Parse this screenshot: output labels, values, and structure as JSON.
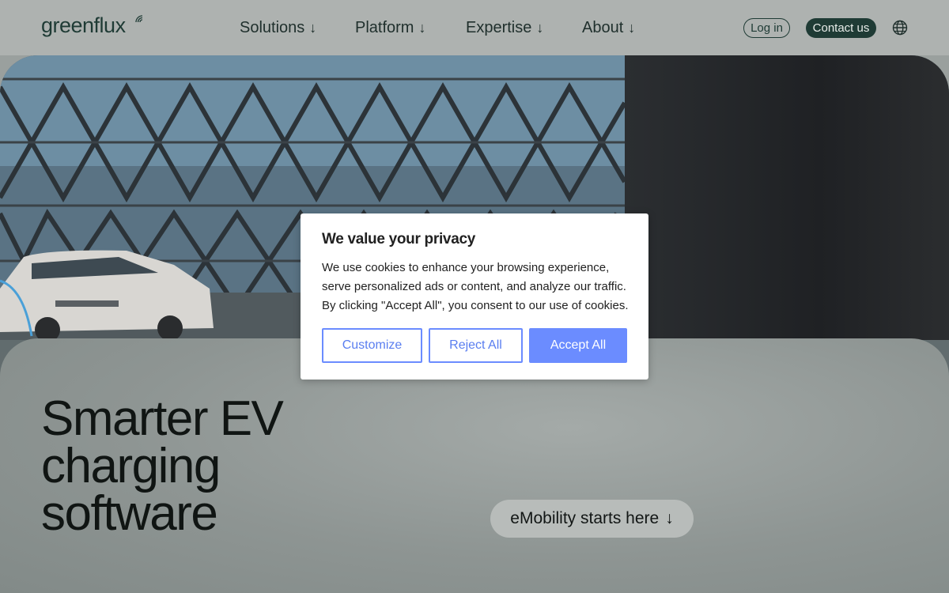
{
  "header": {
    "logo": "greenflux",
    "nav": [
      {
        "label": "Solutions",
        "arrow": "↓"
      },
      {
        "label": "Platform",
        "arrow": "↓"
      },
      {
        "label": "Expertise",
        "arrow": "↓"
      },
      {
        "label": "About",
        "arrow": "↓"
      }
    ],
    "login_label": "Log in",
    "contact_label": "Contact us",
    "language_icon": "globe-icon"
  },
  "hero": {
    "headline_lines": [
      "Smarter EV",
      "charging",
      "software"
    ],
    "cta_label": "eMobility starts here",
    "cta_arrow": "↓"
  },
  "cookie": {
    "title": "We value your privacy",
    "text": "We use cookies to enhance your browsing experience, serve personalized ads or content, and analyze our traffic. By clicking \"Accept All\", you consent to our use of cookies.",
    "customize_label": "Customize",
    "reject_label": "Reject All",
    "accept_label": "Accept All"
  },
  "colors": {
    "brand_dark": "#1f3b35",
    "cookie_accent": "#6b8cff"
  }
}
